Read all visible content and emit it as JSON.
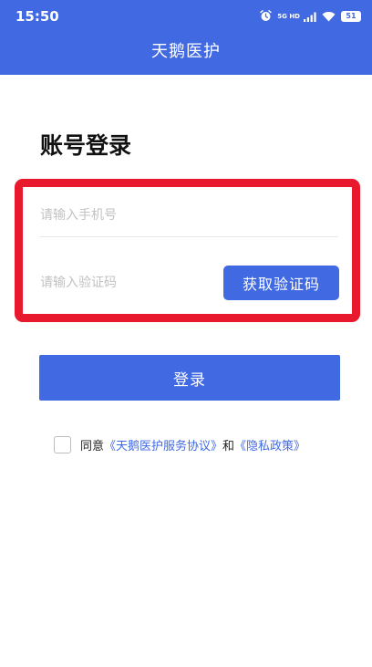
{
  "status_bar": {
    "time": "15:50",
    "network": "5G HD",
    "battery": "51",
    "icons": [
      "alarm-icon",
      "signal-icon",
      "wifi-icon",
      "battery-icon"
    ]
  },
  "header": {
    "title": "天鹅医护"
  },
  "login": {
    "title": "账号登录",
    "phone_placeholder": "请输入手机号",
    "code_placeholder": "请输入验证码",
    "get_code_label": "获取验证码",
    "submit_label": "登录"
  },
  "agreement": {
    "prefix": "同意",
    "service_link": "《天鹅医护服务协议》",
    "and": "和",
    "privacy_link": "《隐私政策》"
  },
  "colors": {
    "primary": "#4169e1",
    "highlight": "#e8192c"
  }
}
